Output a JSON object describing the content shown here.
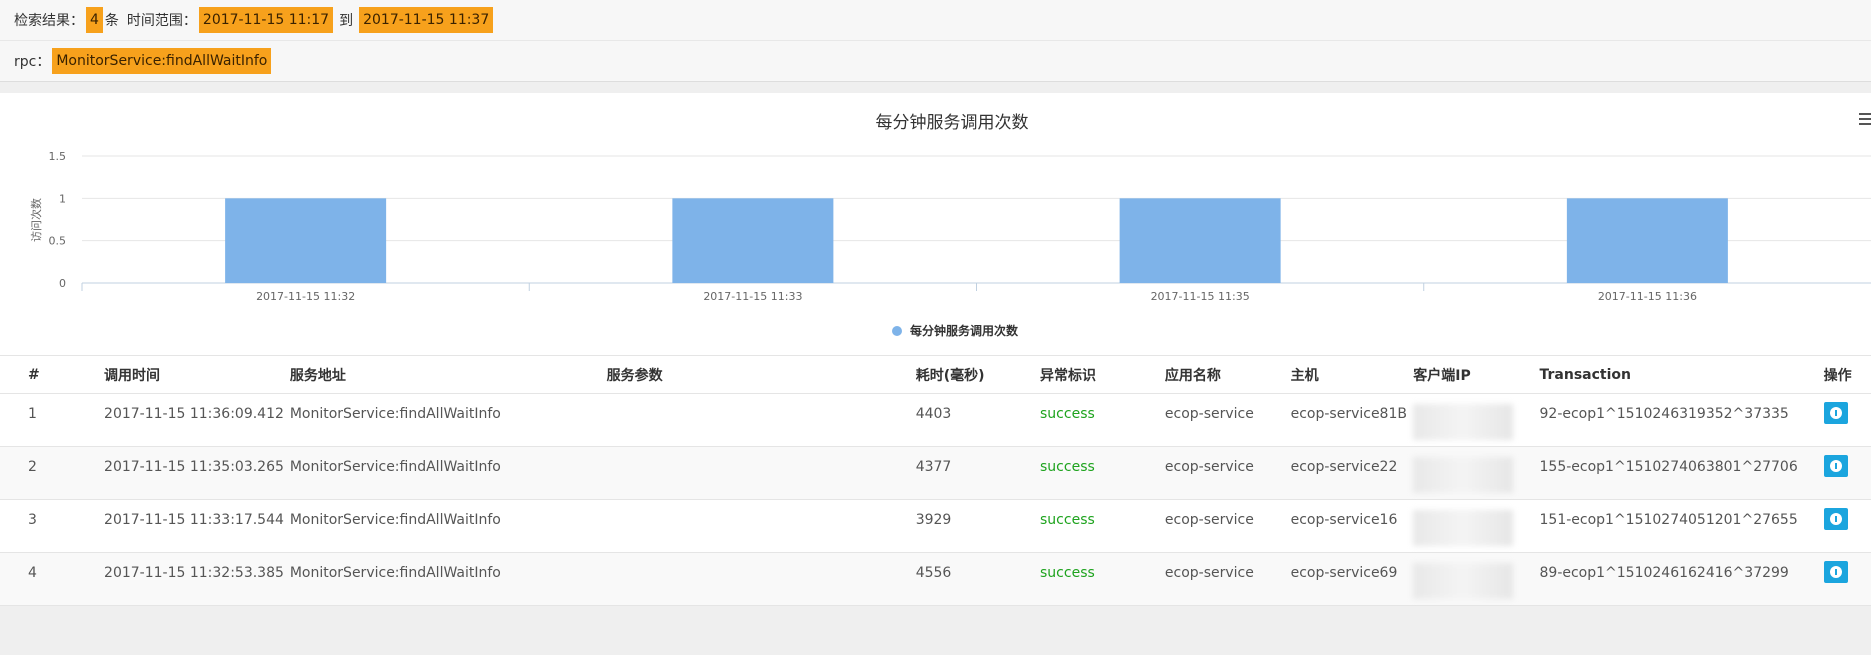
{
  "summary": {
    "result_label": "检索结果：",
    "count": "4",
    "count_unit": "条",
    "range_label": "时间范围：",
    "start_time": "2017-11-15 11:17",
    "to_label": "到",
    "end_time": "2017-11-15 11:37"
  },
  "rpc": {
    "label": "rpc：",
    "value": "MonitorService:findAllWaitInfo"
  },
  "chart_data": {
    "type": "bar",
    "title": "每分钟服务调用次数",
    "ylabel": "访问次数",
    "xlabel": "",
    "categories": [
      "2017-11-15 11:32",
      "2017-11-15 11:33",
      "2017-11-15 11:35",
      "2017-11-15 11:36"
    ],
    "series": [
      {
        "name": "每分钟服务调用次数",
        "values": [
          1,
          1,
          1,
          1
        ],
        "color": "#7eb3e9"
      }
    ],
    "ylim": [
      0,
      1.5
    ],
    "yticks": [
      "0",
      "0.5",
      "1",
      "1.5"
    ],
    "grid": true,
    "legend": "bottom-center"
  },
  "table": {
    "headers": [
      "#",
      "调用时间",
      "服务地址",
      "服务参数",
      "耗时(毫秒)",
      "异常标识",
      "应用名称",
      "主机",
      "客户端IP",
      "Transaction",
      "操作"
    ],
    "rows": [
      {
        "idx": "1",
        "time": "2017-11-15 11:36:09.412",
        "service": "MonitorService:findAllWaitInfo",
        "params": "",
        "cost": "4403",
        "status": "success",
        "app": "ecop-service",
        "host": "ecop-service81B",
        "ip": "",
        "tx": "92-ecop1^1510246319352^37335"
      },
      {
        "idx": "2",
        "time": "2017-11-15 11:35:03.265",
        "service": "MonitorService:findAllWaitInfo",
        "params": "",
        "cost": "4377",
        "status": "success",
        "app": "ecop-service",
        "host": "ecop-service22",
        "ip": "",
        "tx": "155-ecop1^1510274063801^27706"
      },
      {
        "idx": "3",
        "time": "2017-11-15 11:33:17.544",
        "service": "MonitorService:findAllWaitInfo",
        "params": "",
        "cost": "3929",
        "status": "success",
        "app": "ecop-service",
        "host": "ecop-service16",
        "ip": "",
        "tx": "151-ecop1^1510274051201^27655"
      },
      {
        "idx": "4",
        "time": "2017-11-15 11:32:53.385",
        "service": "MonitorService:findAllWaitInfo",
        "params": "",
        "cost": "4556",
        "status": "success",
        "app": "ecop-service",
        "host": "ecop-service69",
        "ip": "",
        "tx": "89-ecop1^1510246162416^37299"
      }
    ]
  },
  "colors": {
    "highlight": "#f7a11c",
    "bar": "#7eb3e9",
    "success": "#1ea31e",
    "button": "#1ba5de"
  },
  "icons": {
    "info": "info-icon",
    "chart_menu": "menu-icon"
  }
}
